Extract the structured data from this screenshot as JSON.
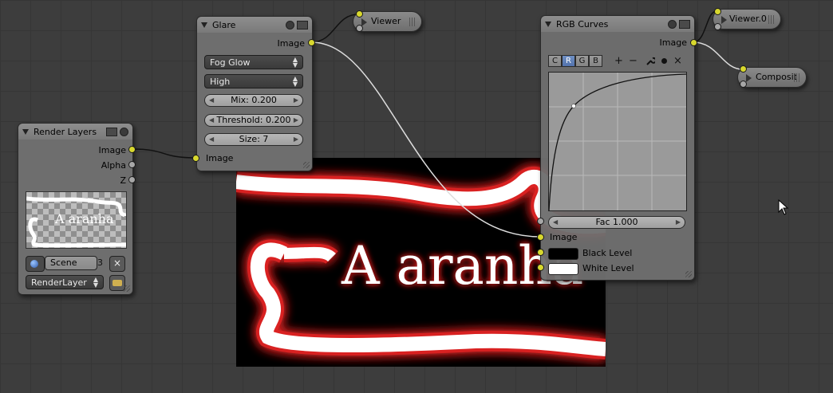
{
  "backdrop": {
    "text": "A aranha"
  },
  "render_layers": {
    "title": "Render Layers",
    "outputs": [
      "Image",
      "Alpha",
      "Z"
    ],
    "preview_text": "A aranha",
    "scene_label": "Scene",
    "scene_users": "3",
    "layer_label": "RenderLayer"
  },
  "glare": {
    "title": "Glare",
    "output": "Image",
    "type": "Fog Glow",
    "quality": "High",
    "mix": "Mix: 0.200",
    "threshold": "Threshold: 0.200",
    "size": "Size: 7",
    "input": "Image"
  },
  "viewer": {
    "title": "Viewer"
  },
  "rgb_curves": {
    "title": "RGB Curves",
    "output": "Image",
    "tabs": [
      "C",
      "R",
      "G",
      "B"
    ],
    "active_tab": "R",
    "tools": [
      "+",
      "−",
      "wrench-icon",
      "dot-icon",
      "×"
    ],
    "fac": "Fac 1.000",
    "input_image": "Image",
    "black_level": "Black Level",
    "white_level": "White Level"
  },
  "viewer0": {
    "title": "Viewer.0"
  },
  "composite": {
    "title": "Composit"
  },
  "colors": {
    "socket_yellow": "#d8d82e",
    "glow_red": "#c81e1e",
    "active_tab": "#5273ad"
  }
}
